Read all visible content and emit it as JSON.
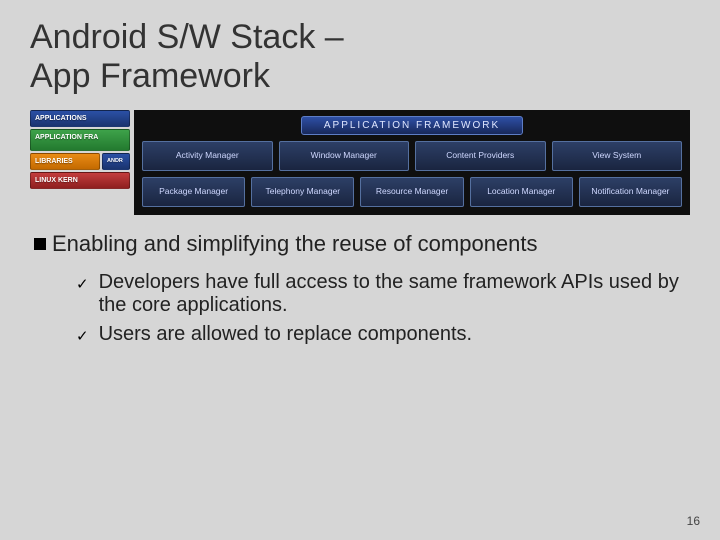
{
  "title_line1": "Android S/W Stack –",
  "title_line2": "App Framework",
  "stack": {
    "apps": "APPLICATIONS",
    "framework": "APPLICATION FRA",
    "libraries": "LIBRARIES",
    "runtime": "ANDR",
    "kernel": "LINUX KERN"
  },
  "fw_header": "APPLICATION FRAMEWORK",
  "fw_row1": [
    "Activity Manager",
    "Window Manager",
    "Content Providers",
    "View System"
  ],
  "fw_row2": [
    "Package Manager",
    "Telephony Manager",
    "Resource Manager",
    "Location Manager",
    "Notification Manager"
  ],
  "bullet_main": "Enabling and simplifying the reuse of components",
  "sub_bullets": [
    "Developers have full access to the same framework APIs used by the core applications.",
    "Users are allowed to replace components."
  ],
  "page_number": "16"
}
